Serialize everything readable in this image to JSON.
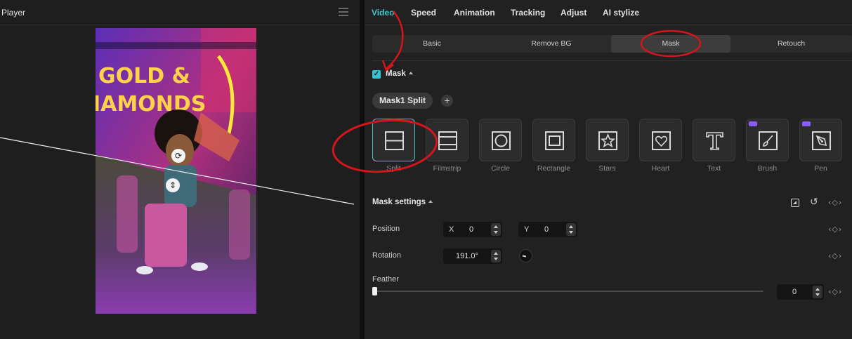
{
  "player": {
    "title": "Player",
    "video_overlay_text": [
      "GOLD &",
      "IAMONDS"
    ]
  },
  "inspector": {
    "tabs": [
      {
        "label": "Video",
        "active": true
      },
      {
        "label": "Speed",
        "active": false
      },
      {
        "label": "Animation",
        "active": false
      },
      {
        "label": "Tracking",
        "active": false
      },
      {
        "label": "Adjust",
        "active": false
      },
      {
        "label": "AI stylize",
        "active": false
      }
    ],
    "sub_tabs": [
      {
        "label": "Basic",
        "active": false
      },
      {
        "label": "Remove BG",
        "active": false
      },
      {
        "label": "Mask",
        "active": true
      },
      {
        "label": "Retouch",
        "active": false
      }
    ],
    "mask": {
      "label": "Mask",
      "enabled": true,
      "chip_label": "Mask1 Split",
      "add_label": "+",
      "shapes": [
        {
          "label": "Split",
          "icon": "split-icon",
          "selected": true,
          "pro": false
        },
        {
          "label": "Filmstrip",
          "icon": "filmstrip-icon",
          "selected": false,
          "pro": false
        },
        {
          "label": "Circle",
          "icon": "circle-icon",
          "selected": false,
          "pro": false
        },
        {
          "label": "Rectangle",
          "icon": "rectangle-icon",
          "selected": false,
          "pro": false
        },
        {
          "label": "Stars",
          "icon": "star-icon",
          "selected": false,
          "pro": false
        },
        {
          "label": "Heart",
          "icon": "heart-icon",
          "selected": false,
          "pro": false
        },
        {
          "label": "Text",
          "icon": "text-icon",
          "selected": false,
          "pro": false
        },
        {
          "label": "Brush",
          "icon": "brush-icon",
          "selected": false,
          "pro": true
        },
        {
          "label": "Pen",
          "icon": "pen-icon",
          "selected": false,
          "pro": true
        }
      ]
    },
    "mask_settings": {
      "label": "Mask settings",
      "position_label": "Position",
      "x_prefix": "X",
      "x_value": "0",
      "y_prefix": "Y",
      "y_value": "0",
      "rotation_label": "Rotation",
      "rotation_value": "191.0°",
      "feather_label": "Feather",
      "feather_value": "0",
      "keyframe_glyph": "‹◇›"
    }
  },
  "colors": {
    "accent": "#3fc6d0",
    "annotation": "#d4161c",
    "pro_badge": "#8a5cff"
  }
}
